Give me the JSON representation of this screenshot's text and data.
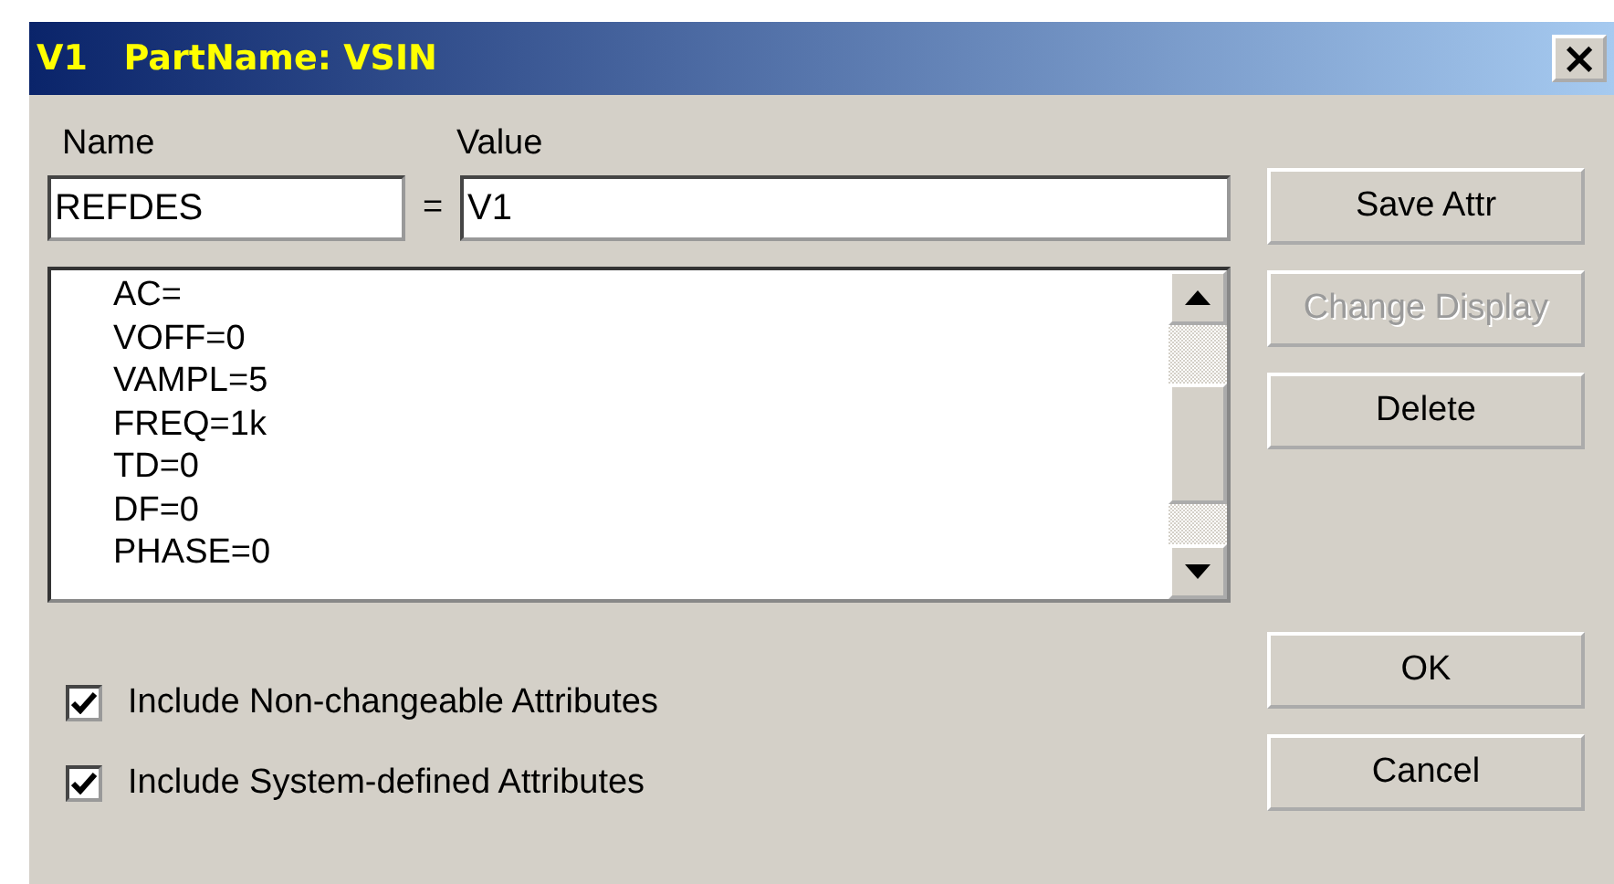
{
  "window": {
    "title": "V1   PartName: VSIN",
    "close": "×"
  },
  "labels": {
    "name": "Name",
    "value": "Value",
    "equals": "="
  },
  "name_field": {
    "value": "REFDES"
  },
  "value_field": {
    "value": "V1"
  },
  "attributes": [
    {
      "text": "AC="
    },
    {
      "text": "VOFF=0"
    },
    {
      "text": "VAMPL=5"
    },
    {
      "text": "FREQ=1k"
    },
    {
      "text": "TD=0"
    },
    {
      "text": "DF=0"
    },
    {
      "text": "PHASE=0"
    }
  ],
  "top_buttons": [
    {
      "label": "Save Attr",
      "disabled": false
    },
    {
      "label": "Change Display",
      "disabled": true
    },
    {
      "label": "Delete",
      "disabled": false
    }
  ],
  "checkboxes": [
    {
      "label": "Include Non-changeable Attributes",
      "checked": true
    },
    {
      "label": "Include System-defined Attributes",
      "checked": true
    }
  ],
  "bottom_buttons": [
    {
      "label": "OK",
      "disabled": false
    },
    {
      "label": "Cancel",
      "disabled": false
    }
  ]
}
